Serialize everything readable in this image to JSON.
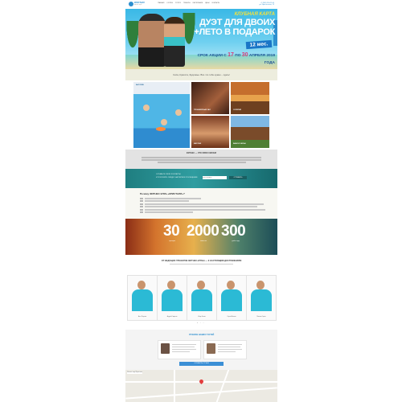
{
  "header": {
    "logo_title": "КРИСТАЛЛ",
    "logo_sub": "фитнес клуб",
    "nav": [
      "ГЛАВНАЯ",
      "О КЛУБЕ",
      "УСЛУГИ",
      "ТРЕНЕРЫ",
      "РАСПИСАНИЕ",
      "ЦЕНЫ",
      "КОНТАКТЫ"
    ],
    "phone_1": "+7 (800) 200-11-00",
    "phone_2": "ул. Кристальная, 15"
  },
  "hero": {
    "club_card": "КЛУБНАЯ КАРТА",
    "line1": "ДУЭТ ДЛЯ ДВОИХ",
    "line2": "+ЛЕТО В ПОДАРОК",
    "months": "12 мес.",
    "promo_prefix": "СРОК АКЦИИ С",
    "promo_from": "17",
    "promo_mid": "ПО",
    "promo_to": "30",
    "promo_suffix": "АПРЕЛЯ 2019 ГОДА"
  },
  "tagline": "Сила, Красота, Здоровье. Все что тебе нужно – здесь!",
  "gallery": {
    "labels": [
      "БАССЕЙН",
      "ТРЕНАЖЕРНЫЙ ЗАЛ",
      "СОЛЯРИЙ",
      "МАССАЖ",
      "БАНИ И САУНЫ"
    ]
  },
  "about": {
    "title": "ФИТНЕС — ЭТО ОБРАЗ ЖИЗНИ"
  },
  "subscribe": {
    "line1": "ОСТАВЬТЕ СВОИ КОНТАКТЫ",
    "line2": "И ПОЛУЧИТЕ СКИДКУ НА ПЕРВОЕ ПОСЕЩЕНИЕ",
    "placeholder": "Ваш телефон",
    "button": "ОТПРАВИТЬ"
  },
  "why": {
    "title": "Почему ФИТНЕС КЛУБ «КРИСТАЛЛ»?"
  },
  "stats": [
    {
      "value": "30",
      "label": "тренеров"
    },
    {
      "value": "2000",
      "label": "клиентов"
    },
    {
      "value": "300",
      "label": "дней в году"
    }
  ],
  "trainers": {
    "title": "ОТ ВЕДУЩИХ ТРЕНЕРОВ ФИТНЕС-КЛУБА — К НАСТОЯЩИМ ДОСТИЖЕНИЯМ",
    "people": [
      {
        "name": "Анна Петрова"
      },
      {
        "name": "Андрей Смирнов"
      },
      {
        "name": "Игорь Белов"
      },
      {
        "name": "Сергей Волков"
      },
      {
        "name": "Максим Орлов"
      }
    ]
  },
  "reviews": {
    "title": "ОТЗЫВЫ НАШИХ ГОСТЕЙ",
    "button": "ОСТАВИТЬ ОТЗЫВ"
  },
  "map": {
    "label": "Фитнес клуб Кристалл"
  }
}
